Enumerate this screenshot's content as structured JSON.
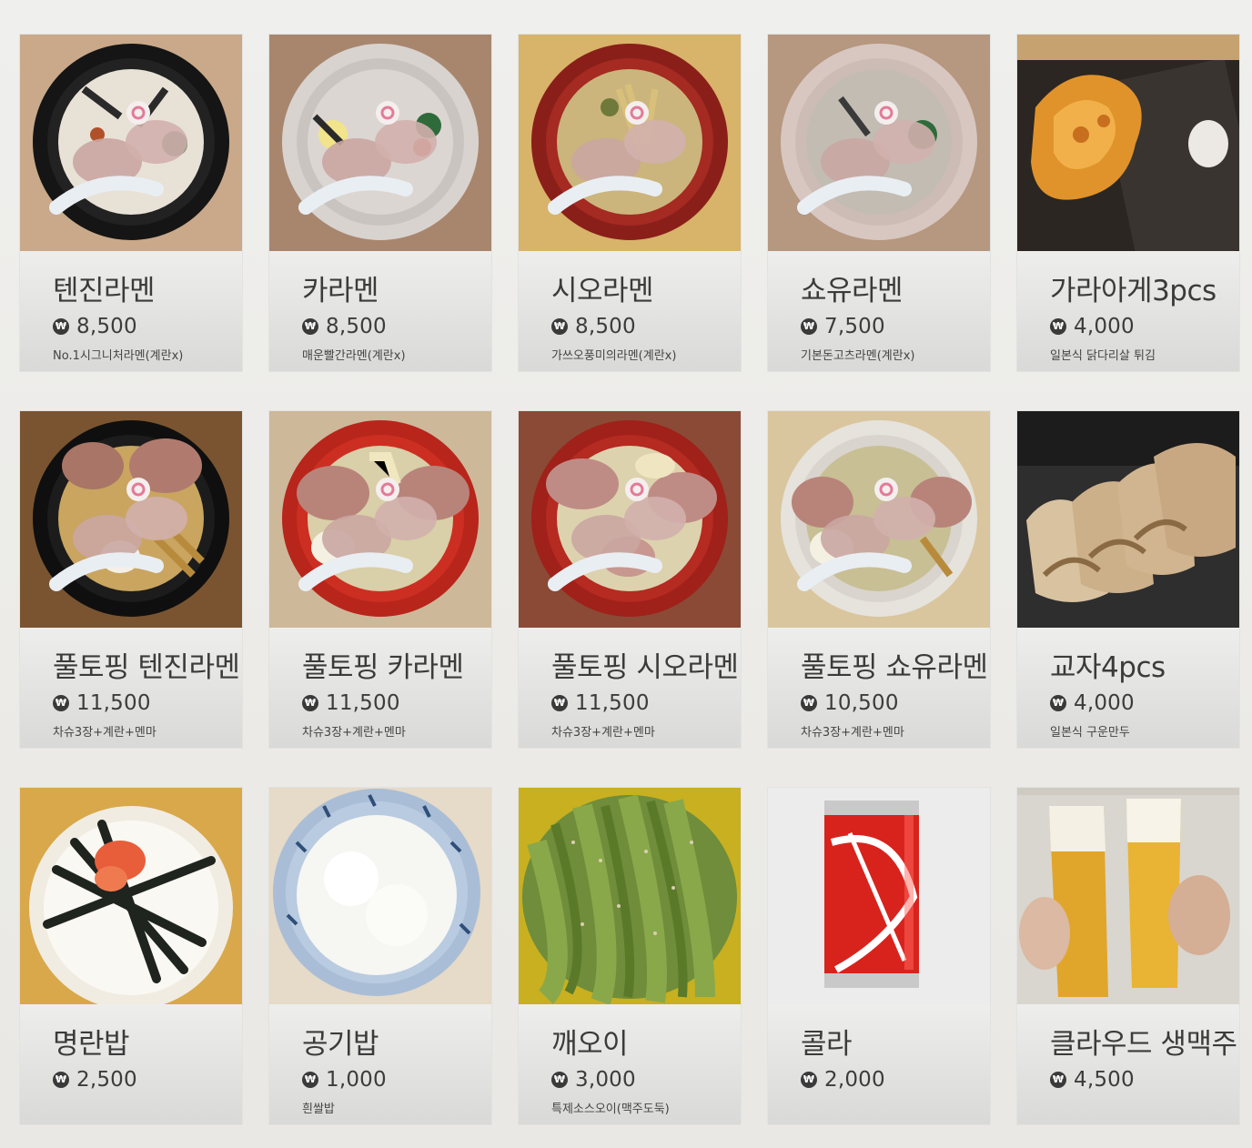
{
  "currency_icon": "won-icon",
  "menu": [
    {
      "name": "텐진라멘",
      "price": "8,500",
      "desc": "No.1시그니처라멘(계란x)",
      "photo": "ramen-tonkotsu"
    },
    {
      "name": "카라멘",
      "price": "8,500",
      "desc": "매운빨간라멘(계란x)",
      "photo": "ramen-spicy"
    },
    {
      "name": "시오라멘",
      "price": "8,500",
      "desc": "가쓰오풍미의라멘(계란x)",
      "photo": "ramen-shio"
    },
    {
      "name": "쇼유라멘",
      "price": "7,500",
      "desc": "기본돈고츠라멘(계란x)",
      "photo": "ramen-shoyu"
    },
    {
      "name": "가라아게3pcs",
      "price": "4,000",
      "desc": "일본식 닭다리살 튀김",
      "photo": "karaage"
    },
    {
      "name": "풀토핑 텐진라멘",
      "price": "11,500",
      "desc": "차슈3장+계란+멘마",
      "photo": "ramen-full-black"
    },
    {
      "name": "풀토핑 카라멘",
      "price": "11,500",
      "desc": "차슈3장+계란+멘마",
      "photo": "ramen-full-red"
    },
    {
      "name": "풀토핑 시오라멘",
      "price": "11,500",
      "desc": "차슈3장+계란+멘마",
      "photo": "ramen-full-red2"
    },
    {
      "name": "풀토핑 쇼유라멘",
      "price": "10,500",
      "desc": "차슈3장+계란+멘마",
      "photo": "ramen-full-white"
    },
    {
      "name": "교자4pcs",
      "price": "4,000",
      "desc": "일본식 구운만두",
      "photo": "gyoza"
    },
    {
      "name": "명란밥",
      "price": "2,500",
      "desc": "",
      "photo": "mentaiko-rice"
    },
    {
      "name": "공기밥",
      "price": "1,000",
      "desc": "흰쌀밥",
      "photo": "rice-bowl"
    },
    {
      "name": "깨오이",
      "price": "3,000",
      "desc": "특제소스오이(맥주도둑)",
      "photo": "cucumber"
    },
    {
      "name": "콜라",
      "price": "2,000",
      "desc": "",
      "photo": "cola-can"
    },
    {
      "name": "클라우드 생맥주",
      "price": "4,500",
      "desc": "",
      "photo": "draft-beer"
    }
  ]
}
